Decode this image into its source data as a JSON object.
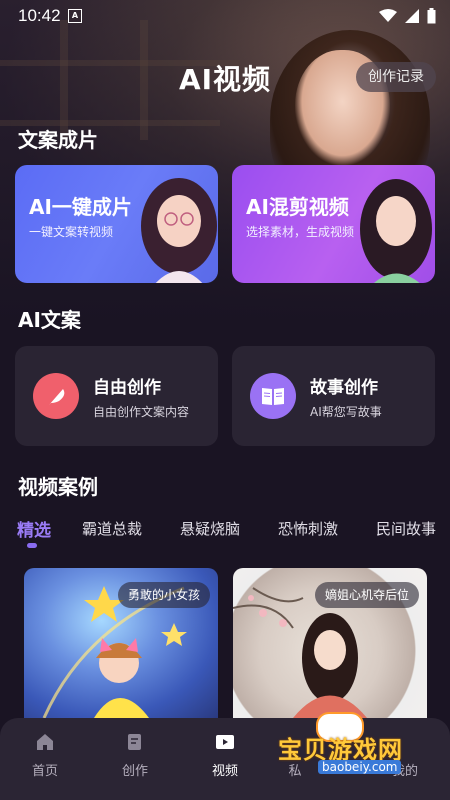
{
  "status_bar": {
    "time": "10:42",
    "notification_icon": "A"
  },
  "header": {
    "title": "AI视频",
    "record_button": "创作记录"
  },
  "section_copy_video": {
    "title": "文案成片",
    "cards": [
      {
        "title": "AI一键成片",
        "subtitle": "一键文案转视频"
      },
      {
        "title": "AI混剪视频",
        "subtitle": "选择素材，生成视频"
      }
    ]
  },
  "section_ai_copy": {
    "title": "AI文案",
    "cards": [
      {
        "title": "自由创作",
        "subtitle": "自由创作文案内容",
        "icon": "feather-icon"
      },
      {
        "title": "故事创作",
        "subtitle": "AI帮您写故事",
        "icon": "book-icon"
      }
    ]
  },
  "section_cases": {
    "title": "视频案例",
    "tabs": [
      "精选",
      "霸道总裁",
      "悬疑烧脑",
      "恐怖刺激",
      "民间故事"
    ],
    "active_tab": 0,
    "items": [
      {
        "tag": "勇敢的小女孩"
      },
      {
        "tag": "嫡姐心机夺后位"
      }
    ]
  },
  "bottom_nav": {
    "items": [
      {
        "label": "首页",
        "icon": "home-icon"
      },
      {
        "label": "创作",
        "icon": "edit-icon"
      },
      {
        "label": "视频",
        "icon": "video-icon",
        "active": true
      },
      {
        "label": "私",
        "icon": "message-icon"
      },
      {
        "label": "我的",
        "icon": "user-icon"
      }
    ]
  },
  "watermark": {
    "text": "宝贝游戏网",
    "url": "baobeiy.com"
  },
  "colors": {
    "accent": "#8a6cf0",
    "card_blue": "#5b6cf5",
    "card_purple": "#a04ee8",
    "background": "#1a1423"
  }
}
